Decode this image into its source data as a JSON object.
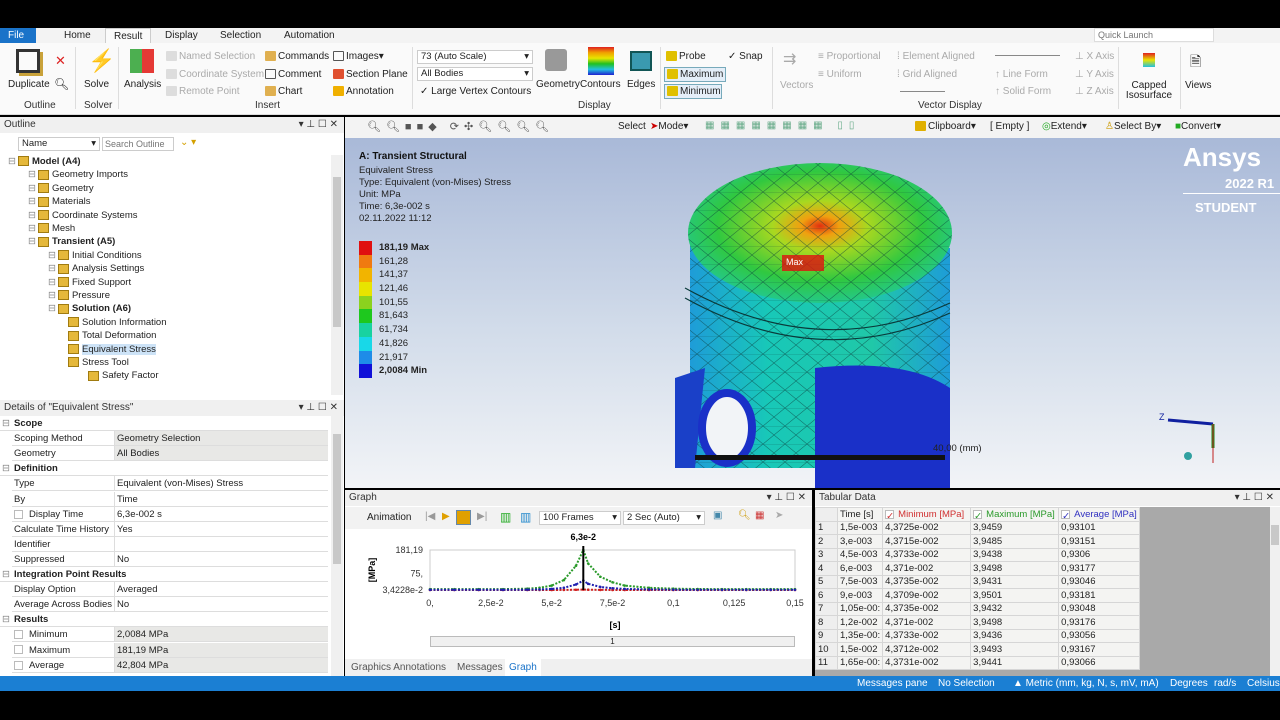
{
  "tabs": [
    "File",
    "Home",
    "Result",
    "Display",
    "Selection",
    "Automation"
  ],
  "quick_launch_placeholder": "Quick Launch",
  "ribbon": {
    "duplicate": "Duplicate",
    "outline_group": "Outline",
    "solve": "Solve",
    "solver_group": "Solver",
    "analysis": "Analysis",
    "named_selection": "Named Selection",
    "coordinate_system": "Coordinate System",
    "remote_point": "Remote Point",
    "commands": "Commands",
    "comment": "Comment",
    "chart": "Chart",
    "images": "Images",
    "section_plane": "Section Plane",
    "annotation": "Annotation",
    "insert_group": "Insert",
    "scale_select": "73 (Auto Scale)",
    "bodies_select": "All Bodies",
    "large_vertex": "Large Vertex Contours",
    "geometry": "Geometry",
    "contours": "Contours",
    "edges": "Edges",
    "display_group": "Display",
    "probe": "Probe",
    "maximum": "Maximum",
    "minimum": "Minimum",
    "snap": "Snap",
    "vectors": "Vectors",
    "proportional": "Proportional",
    "uniform": "Uniform",
    "element_aligned": "Element Aligned",
    "grid_aligned": "Grid Aligned",
    "line_form": "Line Form",
    "solid_form": "Solid Form",
    "x_axis": "X Axis",
    "y_axis": "Y Axis",
    "z_axis": "Z Axis",
    "vector_display_group": "Vector Display",
    "capped_isosurface": "Capped Isosurface",
    "views": "Views"
  },
  "viewport_toolbar": {
    "select": "Select",
    "mode": "Mode",
    "clipboard": "Clipboard",
    "empty": "[ Empty ]",
    "extend": "Extend",
    "select_by": "Select By",
    "convert": "Convert"
  },
  "outline": {
    "title": "Outline",
    "filter": "Name",
    "search_placeholder": "Search Outline",
    "items": [
      {
        "label": "Model (A4)",
        "level": 0,
        "bold": true
      },
      {
        "label": "Geometry Imports",
        "level": 1
      },
      {
        "label": "Geometry",
        "level": 1
      },
      {
        "label": "Materials",
        "level": 1
      },
      {
        "label": "Coordinate Systems",
        "level": 1
      },
      {
        "label": "Mesh",
        "level": 1
      },
      {
        "label": "Transient (A5)",
        "level": 1,
        "bold": true
      },
      {
        "label": "Initial Conditions",
        "level": 2
      },
      {
        "label": "Analysis Settings",
        "level": 2
      },
      {
        "label": "Fixed Support",
        "level": 2
      },
      {
        "label": "Pressure",
        "level": 2
      },
      {
        "label": "Solution (A6)",
        "level": 2,
        "bold": true
      },
      {
        "label": "Solution Information",
        "level": 3
      },
      {
        "label": "Total Deformation",
        "level": 3
      },
      {
        "label": "Equivalent Stress",
        "level": 3,
        "selected": true
      },
      {
        "label": "Stress Tool",
        "level": 3
      },
      {
        "label": "Safety Factor",
        "level": 4
      }
    ]
  },
  "details": {
    "title": "Details of \"Equivalent Stress\"",
    "rows": [
      {
        "section": "Scope"
      },
      {
        "k": "Scoping Method",
        "v": "Geometry Selection",
        "g": true
      },
      {
        "k": "Geometry",
        "v": "All Bodies",
        "g": true
      },
      {
        "section": "Definition"
      },
      {
        "k": "Type",
        "v": "Equivalent (von-Mises) Stress"
      },
      {
        "k": "By",
        "v": "Time"
      },
      {
        "k": "Display Time",
        "v": "6,3e-002 s",
        "cb": true
      },
      {
        "k": "Calculate Time History",
        "v": "Yes"
      },
      {
        "k": "Identifier",
        "v": ""
      },
      {
        "k": "Suppressed",
        "v": "No"
      },
      {
        "section": "Integration Point Results"
      },
      {
        "k": "Display Option",
        "v": "Averaged"
      },
      {
        "k": "Average Across Bodies",
        "v": "No"
      },
      {
        "section": "Results"
      },
      {
        "k": "Minimum",
        "v": "2,0084 MPa",
        "cb": true,
        "g": true
      },
      {
        "k": "Maximum",
        "v": "181,19 MPa",
        "cb": true,
        "g": true
      },
      {
        "k": "Average",
        "v": "42,804 MPa",
        "cb": true,
        "g": true
      }
    ]
  },
  "viewport": {
    "title": "A: Transient Structural",
    "line1": "Equivalent Stress",
    "line2": "Type: Equivalent (von-Mises) Stress",
    "line3": "Unit: MPa",
    "line4": "Time: 6,3e-002 s",
    "line5": "02.11.2022 11:12",
    "legend": [
      {
        "v": "181,19 Max",
        "c": "#e01010"
      },
      {
        "v": "161,28",
        "c": "#f07a10"
      },
      {
        "v": "141,37",
        "c": "#f2b400"
      },
      {
        "v": "121,46",
        "c": "#e8e400"
      },
      {
        "v": "101,55",
        "c": "#8cd21e"
      },
      {
        "v": "81,643",
        "c": "#1ec81e"
      },
      {
        "v": "61,734",
        "c": "#18d2a0"
      },
      {
        "v": "41,826",
        "c": "#18d8e8"
      },
      {
        "v": "21,917",
        "c": "#1e8ce8"
      },
      {
        "v": "2,0084 Min",
        "c": "#1010d8"
      }
    ],
    "max_label": "Max",
    "scale_label": "40,00 (mm)",
    "brand": "Ansys",
    "version": "2022 R1",
    "edition": "STUDENT"
  },
  "graph": {
    "title": "Graph",
    "animation": "Animation",
    "frames": "100 Frames",
    "duration": "2 Sec (Auto)",
    "slider_label": "1"
  },
  "chart_data": {
    "type": "line",
    "xlabel": "[s]",
    "ylabel": "[MPa]",
    "marker_label": "6,3e-2",
    "marker_x": 0.063,
    "xlim": [
      0,
      0.15
    ],
    "ylim": [
      0.034228,
      181.19
    ],
    "xticks": [
      "0,",
      "2,5e-2",
      "5,e-2",
      "7,5e-2",
      "0,1",
      "0,125",
      "0,15"
    ],
    "xtick_values": [
      0,
      0.025,
      0.05,
      0.075,
      0.1,
      0.125,
      0.15
    ],
    "yticks": [
      "181,19",
      "75,",
      "3,4228e-2"
    ],
    "ytick_values": [
      181.19,
      75,
      0.034228
    ],
    "x": [
      0,
      0.01,
      0.02,
      0.03,
      0.04,
      0.045,
      0.05,
      0.055,
      0.06,
      0.063,
      0.065,
      0.07,
      0.075,
      0.08,
      0.09,
      0.1,
      0.11,
      0.12,
      0.13,
      0.14,
      0.15
    ],
    "series": [
      {
        "name": "Minimum [MPa]",
        "color": "#d02020",
        "values": [
          0.044,
          0.044,
          0.044,
          0.044,
          0.05,
          0.08,
          0.15,
          0.4,
          1.2,
          2.0084,
          1.4,
          0.5,
          0.2,
          0.1,
          0.06,
          0.05,
          0.044,
          0.044,
          0.044,
          0.044,
          0.044
        ]
      },
      {
        "name": "Maximum [MPa]",
        "color": "#2a9a2a",
        "values": [
          3.9,
          3.9,
          3.9,
          4.0,
          6,
          10,
          20,
          45,
          110,
          181.19,
          120,
          60,
          35,
          20,
          10,
          6,
          4.5,
          4,
          3.9,
          3.9,
          3.9
        ]
      },
      {
        "name": "Average [MPa]",
        "color": "#2020b0",
        "values": [
          0.93,
          0.93,
          0.93,
          1,
          1.5,
          2.5,
          5,
          10,
          25,
          42.8,
          28,
          14,
          8,
          5,
          2.5,
          1.5,
          1.1,
          1,
          0.93,
          0.93,
          0.93
        ]
      }
    ]
  },
  "tabular": {
    "title": "Tabular Data",
    "headers": [
      "Time [s]",
      "Minimum [MPa]",
      "Maximum [MPa]",
      "Average [MPa]"
    ],
    "rows": [
      [
        "1",
        "1,5e-003",
        "4,3725e-002",
        "3,9459",
        "0,93101"
      ],
      [
        "2",
        "3,e-003",
        "4,3715e-002",
        "3,9485",
        "0,93151"
      ],
      [
        "3",
        "4,5e-003",
        "4,3733e-002",
        "3,9438",
        "0,9306"
      ],
      [
        "4",
        "6,e-003",
        "4,371e-002",
        "3,9498",
        "0,93177"
      ],
      [
        "5",
        "7,5e-003",
        "4,3735e-002",
        "3,9431",
        "0,93046"
      ],
      [
        "6",
        "9,e-003",
        "4,3709e-002",
        "3,9501",
        "0,93181"
      ],
      [
        "7",
        "1,05e-00:",
        "4,3735e-002",
        "3,9432",
        "0,93048"
      ],
      [
        "8",
        "1,2e-002",
        "4,371e-002",
        "3,9498",
        "0,93176"
      ],
      [
        "9",
        "1,35e-00:",
        "4,3733e-002",
        "3,9436",
        "0,93056"
      ],
      [
        "10",
        "1,5e-002",
        "4,3712e-002",
        "3,9493",
        "0,93167"
      ],
      [
        "11",
        "1,65e-00:",
        "4,3731e-002",
        "3,9441",
        "0,93066"
      ]
    ]
  },
  "bottom_tabs": [
    "Graphics Annotations",
    "Messages",
    "Graph"
  ],
  "status": {
    "messages": "Messages pane",
    "selection": "No Selection",
    "units": "▲ Metric (mm, kg, N, s, mV, mA)",
    "angle": "Degrees",
    "rot": "rad/s",
    "temp": "Celsius"
  }
}
